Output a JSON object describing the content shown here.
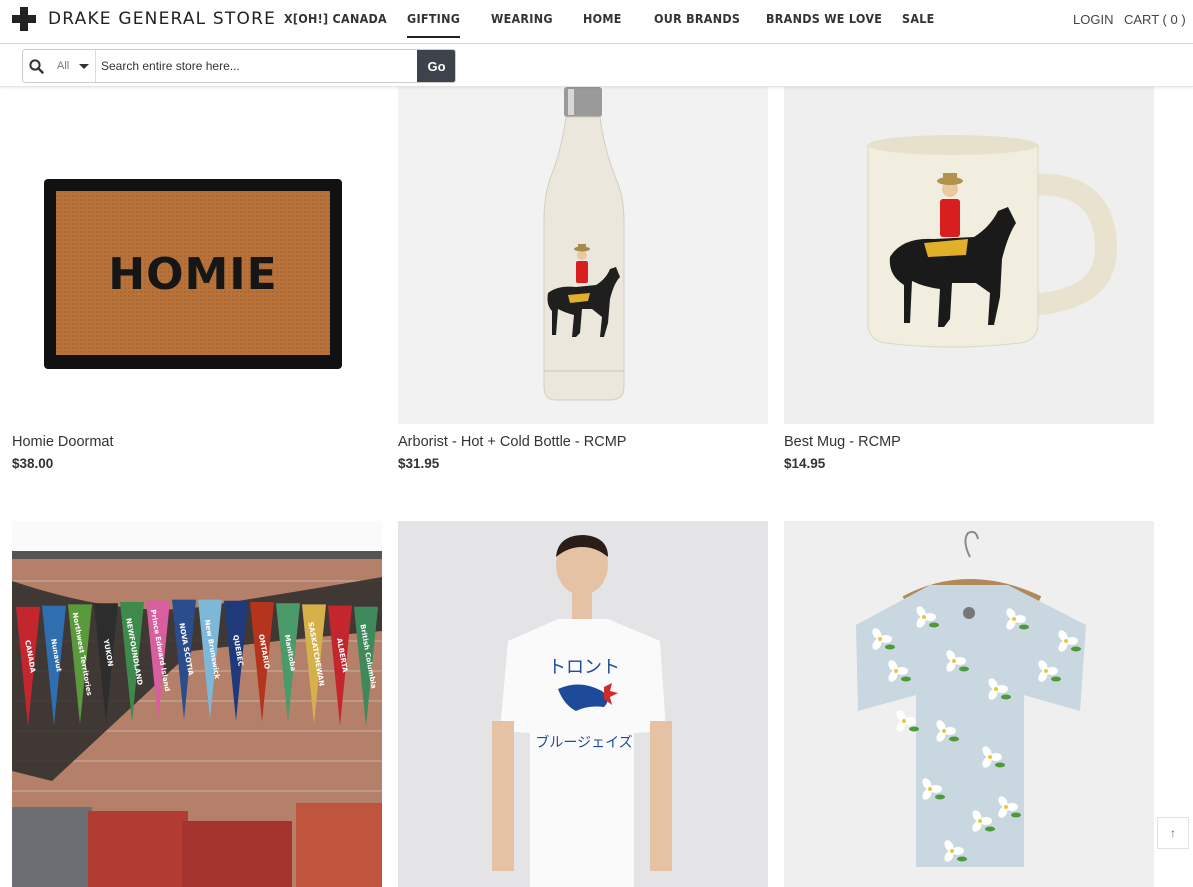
{
  "brand": {
    "name": "DRAKE GENERAL STORE"
  },
  "nav": {
    "items": [
      {
        "label": "X[OH!] CANADA",
        "active": false
      },
      {
        "label": "GIFTING",
        "active": true
      },
      {
        "label": "WEARING",
        "active": false
      },
      {
        "label": "HOME",
        "active": false
      },
      {
        "label": "OUR BRANDS",
        "active": false
      },
      {
        "label": "BRANDS WE LOVE",
        "active": false
      },
      {
        "label": "SALE",
        "active": false
      }
    ],
    "login": "LOGIN",
    "cart": "CART ( 0 )"
  },
  "search": {
    "scope": "All",
    "placeholder": "Search entire store here...",
    "button": "Go"
  },
  "products": [
    {
      "name": "Homie Doormat",
      "price": "$38.00",
      "image_text": "HOMIE"
    },
    {
      "name": "Arborist - Hot + Cold Bottle - RCMP",
      "price": "$31.95"
    },
    {
      "name": "Best Mug - RCMP",
      "price": "$14.95"
    },
    {
      "name": "",
      "price": "",
      "image_text": [
        "CANADA",
        "Nunavut",
        "Northwest Territories",
        "YUKON",
        "NEWFOUNDLAND",
        "Prince Edward Island",
        "NOVA SCOTIA",
        "New Brunswick",
        "QUEBEC",
        "ONTARIO",
        "Manitoba",
        "SASKATCHEWAN",
        "ALBERTA",
        "British Columbia"
      ]
    },
    {
      "name": "",
      "price": "",
      "image_text": [
        "トロント",
        "ブルージェイズ"
      ]
    },
    {
      "name": "",
      "price": ""
    }
  ],
  "scroll_top": {
    "icon": "arrow-up-icon",
    "glyph": "↑"
  },
  "colors": {
    "go_button": "#3d434a",
    "mountie_red": "#d81e1e",
    "doormat": "#b9733a"
  }
}
